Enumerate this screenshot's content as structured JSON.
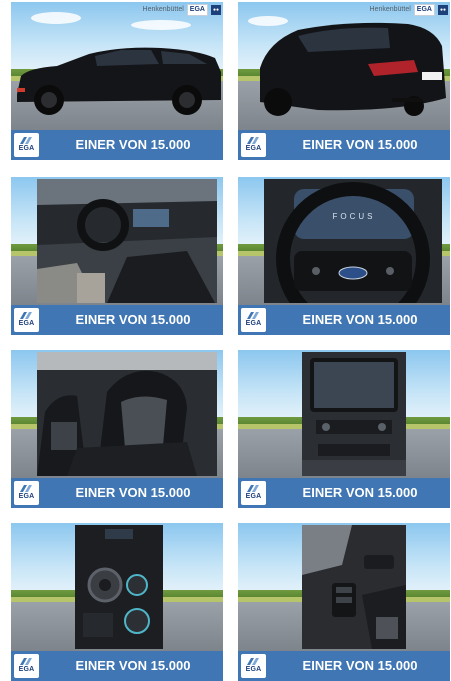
{
  "dealer_name": "Henkenbüttel",
  "brand": "EGA",
  "cards": [
    {
      "caption": "EINER VON 15.000",
      "logo": "EGA",
      "photo": "car-exterior-side",
      "dealer": "Henkenbüttel"
    },
    {
      "caption": "EINER VON 15.000",
      "logo": "EGA",
      "photo": "car-exterior-rear",
      "dealer": "Henkenbüttel"
    },
    {
      "caption": "EINER VON 15.000",
      "logo": "EGA",
      "photo": "interior-dashboard"
    },
    {
      "caption": "EINER VON 15.000",
      "logo": "EGA",
      "photo": "steering-wheel",
      "wheel_text": "FOCUS"
    },
    {
      "caption": "EINER VON 15.000",
      "logo": "EGA",
      "photo": "sport-seats"
    },
    {
      "caption": "EINER VON 15.000",
      "logo": "EGA",
      "photo": "infotainment-screen"
    },
    {
      "caption": "EINER VON 15.000",
      "logo": "EGA",
      "photo": "gear-selector"
    },
    {
      "caption": "EINER VON 15.000",
      "logo": "EGA",
      "photo": "door-panel"
    }
  ],
  "colors": {
    "bar": "#3f76b3",
    "car": "#121315",
    "sky": "#8cc7ef"
  }
}
